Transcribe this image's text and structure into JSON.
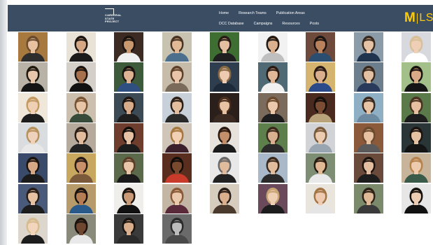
{
  "header": {
    "background": "#3a4d63",
    "logo": {
      "text_lines": [
        "CAREERAL",
        "STATE",
        "PROJECT"
      ],
      "subtitle": ""
    },
    "nav_row_1": [
      {
        "label": "Home"
      },
      {
        "label": "Research Teams"
      },
      {
        "label": "Publication Areas"
      }
    ],
    "nav_row_2": [
      {
        "label": "DCC Database"
      },
      {
        "label": "Campaigns"
      },
      {
        "label": "Resources"
      },
      {
        "label": "Posts"
      }
    ],
    "brand": {
      "mark": "M",
      "name": "LSA",
      "color": "#ffcb05"
    }
  },
  "gallery": {
    "photos": [
      {
        "bg": "#a8793f",
        "hair": "#6b4c2e",
        "skin": "#e8c2a0",
        "shirt": "#2d2d2d"
      },
      {
        "bg": "#e9e2d6",
        "hair": "#1e1612",
        "skin": "#d6a784",
        "shirt": "#1b1b1b"
      },
      {
        "bg": "#3b2b22",
        "hair": "#1a1411",
        "skin": "#c9986f",
        "shirt": "#f0f0f0"
      },
      {
        "bg": "#c8c2b1",
        "hair": "#4a3524",
        "skin": "#e2b996",
        "shirt": "#4d6f8e"
      },
      {
        "bg": "#3e6e31",
        "hair": "#2a1d16",
        "skin": "#e4bfa1",
        "shirt": "#1f1f1f"
      },
      {
        "bg": "#f2f2f2",
        "hair": "#241a14",
        "skin": "#dbb08f",
        "shirt": "#bfbfbf"
      },
      {
        "bg": "#6e4a3c",
        "hair": "#1d1512",
        "skin": "#b9825c",
        "shirt": "#2b4d6f"
      },
      {
        "bg": "#8b9ba8",
        "hair": "#3a2b20",
        "skin": "#e6c3a5",
        "shirt": "#20354d"
      },
      {
        "bg": "#d7d9de",
        "hair": "#d8c19a",
        "skin": "#efd0b7",
        "shirt": "#ffffff"
      },
      {
        "bg": "#b9b2a6",
        "hair": "#20190f",
        "skin": "#e7c6ab",
        "shirt": "#141414"
      },
      {
        "bg": "#d4d0c9",
        "hair": "#1b1410",
        "skin": "#a8714d",
        "shirt": "#111111"
      },
      {
        "bg": "#3d5a3a",
        "hair": "#1c1410",
        "skin": "#ddb394",
        "shirt": "#2f4f80"
      },
      {
        "bg": "#c7bca9",
        "hair": "#5e412a",
        "skin": "#e8c5a8",
        "shirt": "#7a6a5a"
      },
      {
        "bg": "#2f3e4f",
        "hair": "#8a6a44",
        "skin": "#edcab0",
        "shirt": "#1d2a3a"
      },
      {
        "bg": "#4f6a74",
        "hair": "#2a1b14",
        "skin": "#e1b897",
        "shirt": "#f1f1f1"
      },
      {
        "bg": "#d4b46e",
        "hair": "#2b1d15",
        "skin": "#d9ae8d",
        "shirt": "#2b4a8a"
      },
      {
        "bg": "#6d7f8c",
        "hair": "#3a2a1e",
        "skin": "#e4c1a3",
        "shirt": "#2a3a5a"
      },
      {
        "bg": "#a3c08a",
        "hair": "#1a120e",
        "skin": "#d8aa87",
        "shirt": "#151515"
      },
      {
        "bg": "#efe7da",
        "hair": "#c49b62",
        "skin": "#f0d0b5",
        "shirt": "#1d1d1d"
      },
      {
        "bg": "#cdbfae",
        "hair": "#7a5535",
        "skin": "#e9c5a7",
        "shirt": "#384b3a"
      },
      {
        "bg": "#3c4a55",
        "hair": "#1d1511",
        "skin": "#d8ac8a",
        "shirt": "#1e1e1e"
      },
      {
        "bg": "#c8d1da",
        "hair": "#2c2018",
        "skin": "#e4bf9f",
        "shirt": "#2a2a2a"
      },
      {
        "bg": "#2a1f1a",
        "hair": "#4a2e1d",
        "skin": "#e7c3a4",
        "shirt": "#3a2a22"
      },
      {
        "bg": "#7a6b5c",
        "hair": "#6a4a2e",
        "skin": "#eac8ab",
        "shirt": "#1d1d1d"
      },
      {
        "bg": "#4a2a1f",
        "hair": "#150f0c",
        "skin": "#7a4d34",
        "shirt": "#b8a37a"
      },
      {
        "bg": "#8eafc4",
        "hair": "#3a2a20",
        "skin": "#e7c4a6",
        "shirt": "#6e8aa0"
      },
      {
        "bg": "#5a7a4a",
        "hair": "#4a3222",
        "skin": "#e6c0a0",
        "shirt": "#1d1d1d"
      },
      {
        "bg": "#d9dde0",
        "hair": "#b8925e",
        "skin": "#efd2bb",
        "shirt": "#e8e8e8"
      },
      {
        "bg": "#b5aa9c",
        "hair": "#2a1e16",
        "skin": "#e2bc9c",
        "shirt": "#222222"
      },
      {
        "bg": "#6e3d2e",
        "hair": "#120d0a",
        "skin": "#e5c2a6",
        "shirt": "#1c1c1c"
      },
      {
        "bg": "#cfc5b8",
        "hair": "#a7783f",
        "skin": "#f1d0b6",
        "shirt": "#3b1f2a"
      },
      {
        "bg": "#e7e3dc",
        "hair": "#2a1a12",
        "skin": "#c38f6a",
        "shirt": "#1b1b1b"
      },
      {
        "bg": "#5d7f4c",
        "hair": "#3a2a1e",
        "skin": "#d9b08f",
        "shirt": "#2a2a2a"
      },
      {
        "bg": "#d1d3d6",
        "hair": "#7a5a3a",
        "skin": "#ecccb1",
        "shirt": "#9aa5b2"
      },
      {
        "bg": "#8a5a3a",
        "hair": "#6b4a2f",
        "skin": "#e7c2a2",
        "shirt": "#5a5a5a"
      },
      {
        "bg": "#2a3538",
        "hair": "#1b130f",
        "skin": "#e4c1a3",
        "shirt": "#141414"
      },
      {
        "bg": "#3a4a6a",
        "hair": "#1b1410",
        "skin": "#d7a886",
        "shirt": "#1b1b1b"
      },
      {
        "bg": "#c8a85e",
        "hair": "#2a1d15",
        "skin": "#c8916a",
        "shirt": "#7a5a3a"
      },
      {
        "bg": "#5a6a4a",
        "hair": "#5a3e28",
        "skin": "#e9c6a8",
        "shirt": "#1a1a1a"
      },
      {
        "bg": "#5a2e1e",
        "hair": "#120c0a",
        "skin": "#7a4a2e",
        "shirt": "#c83a2a"
      },
      {
        "bg": "#e8e8e8",
        "hair": "#6a6a6a",
        "skin": "#e0bb9c",
        "shirt": "#222222"
      },
      {
        "bg": "#a9b9c9",
        "hair": "#3a2a1e",
        "skin": "#e2bd9d",
        "shirt": "#2a2a2a"
      },
      {
        "bg": "#7d8e74",
        "hair": "#2a1d14",
        "skin": "#e1b995",
        "shirt": "#e9e9e9"
      },
      {
        "bg": "#6a4a3a",
        "hair": "#1d1410",
        "skin": "#e4bea0",
        "shirt": "#1d1d1d"
      },
      {
        "bg": "#c7b49a",
        "hair": "#b6834e",
        "skin": "#edcbaf",
        "shirt": "#3a5a4a"
      },
      {
        "bg": "#4a5a7a",
        "hair": "#2a1f18",
        "skin": "#e6c2a3",
        "shirt": "#1d1d1d"
      },
      {
        "bg": "#b79b6a",
        "hair": "#1a130f",
        "skin": "#b57d54",
        "shirt": "#2a5a8a"
      },
      {
        "bg": "#f0eeea",
        "hair": "#1b140f",
        "skin": "#c99a75",
        "shirt": "#111111"
      },
      {
        "bg": "#c4b6a4",
        "hair": "#8a5a36",
        "skin": "#ebc9ac",
        "shirt": "#5a2a3a"
      },
      {
        "bg": "#d6cdbf",
        "hair": "#2a1f18",
        "skin": "#d9af8e",
        "shirt": "#4a3a2e"
      },
      {
        "bg": "#6a4a5a",
        "hair": "#c9a574",
        "skin": "#efcfb4",
        "shirt": "#1d1d1d"
      },
      {
        "bg": "#e9e4dc",
        "hair": "#a37546",
        "skin": "#eecbb0",
        "shirt": "#e5e5e5"
      },
      {
        "bg": "#7a8a6a",
        "hair": "#2f2218",
        "skin": "#e0b997",
        "shirt": "#3a3a3a"
      },
      {
        "bg": "#e6e6e6",
        "hair": "#17110d",
        "skin": "#ecccb3",
        "shirt": "#111111"
      },
      {
        "bg": "#dcd6cc",
        "hair": "#d6bc8e",
        "skin": "#f2d5bd",
        "shirt": "#1d1d1d"
      },
      {
        "bg": "#8a8a7a",
        "hair": "#1a130f",
        "skin": "#6f4630",
        "shirt": "#e9e9e9"
      },
      {
        "bg": "#3a3a3a",
        "hair": "#1a1410",
        "skin": "#d8ae8c",
        "shirt": "#2a2a2a"
      },
      {
        "bg": "#6a6a6a",
        "hair": "#2b2b2b",
        "skin": "#bcbcbc",
        "shirt": "#4a4a4a"
      }
    ]
  }
}
